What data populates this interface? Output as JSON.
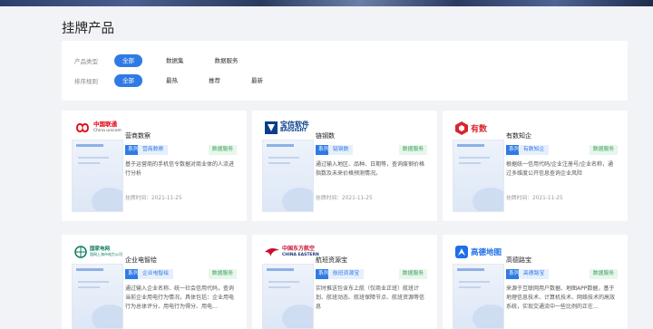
{
  "page": {
    "title": "挂牌产品"
  },
  "filters": {
    "product_type": {
      "label": "产品类型",
      "options": [
        "全部",
        "数据集",
        "数据服务"
      ],
      "selected": "全部"
    },
    "sort": {
      "label": "排序规则",
      "options": [
        "全部",
        "最热",
        "推荐",
        "最新"
      ],
      "selected": "全部"
    }
  },
  "cards": [
    {
      "logo_text": "中国联通",
      "logo_sub": "China unicom",
      "logo_color": "#e60012",
      "logo_icon": "unicom-knot-icon",
      "name": "营商数察",
      "series": "系列",
      "series_name": "营商数察",
      "data_tag": "数据服务",
      "desc": "基于运营商的手机信令数据对商业体的人流进行分析",
      "date_label": "挂牌时间：",
      "date": "2021-11-25"
    },
    {
      "logo_text": "宝信软件",
      "logo_sub": "BAOSIGHT",
      "logo_color": "#0b3e8c",
      "logo_icon": "baosight-mark-icon",
      "name": "链钢数",
      "series": "系列",
      "series_name": "链钢数",
      "data_tag": "数据服务",
      "desc": "通过输入地区、品种、日期等，查询废钢价格指数及未来价格预测情况。",
      "date_label": "挂牌时间：",
      "date": "2021-11-25"
    },
    {
      "logo_text": "有数",
      "logo_sub": "",
      "logo_color": "#d8262f",
      "logo_icon": "youshu-hex-icon",
      "name": "有数知企",
      "series": "系列",
      "series_name": "有数知企",
      "data_tag": "数据服务",
      "desc": "根据统一信用代码/企业注册号/企业名称，通过多维度公开信息查询企业风险",
      "date_label": "挂牌时间：",
      "date": "2021-11-25"
    },
    {
      "logo_text": "国家电网",
      "logo_sub": "国网上海市电力公司",
      "logo_color": "#0a7a5e",
      "logo_icon": "sgcc-globe-icon",
      "name": "企业电智绘",
      "series": "系列",
      "series_name": "企业电智绘",
      "data_tag": "数据服务",
      "desc": "通过输入企业名称、统一社会信用代码，查询当前企业用电行为情况，具体包括：企业用电行为总体评分、用电行为得分、用电…",
      "date_label": "挂牌时间：",
      "date": "2021-11-25"
    },
    {
      "logo_text": "中国东方航空",
      "logo_sub": "CHINA EASTERN",
      "logo_color": "#c8102e",
      "logo_icon": "swallow-icon",
      "name": "航班资源宝",
      "series": "系列",
      "series_name": "航班资源宝",
      "data_tag": "数据服务",
      "desc": "实时推送包含东上航（仅商业正班）航班计划、航班动态、航班保障节点、航班资源等信息",
      "date_label": "挂牌时间：",
      "date": "2021-11-25"
    },
    {
      "logo_text": "高德地图",
      "logo_sub": "",
      "logo_color": "#1f6fe8",
      "logo_icon": "amap-arrow-icon",
      "name": "高德路宝",
      "series": "系列",
      "series_name": "高德路宝",
      "data_tag": "数据服务",
      "desc": "来源于互联网用户数据、地图APP数据，基于地理信息技术、计算机技术、网络技术的高效系统，实现交通流中一些比例的正在…",
      "date_label": "挂牌时间：",
      "date": "2021-11-25"
    }
  ]
}
